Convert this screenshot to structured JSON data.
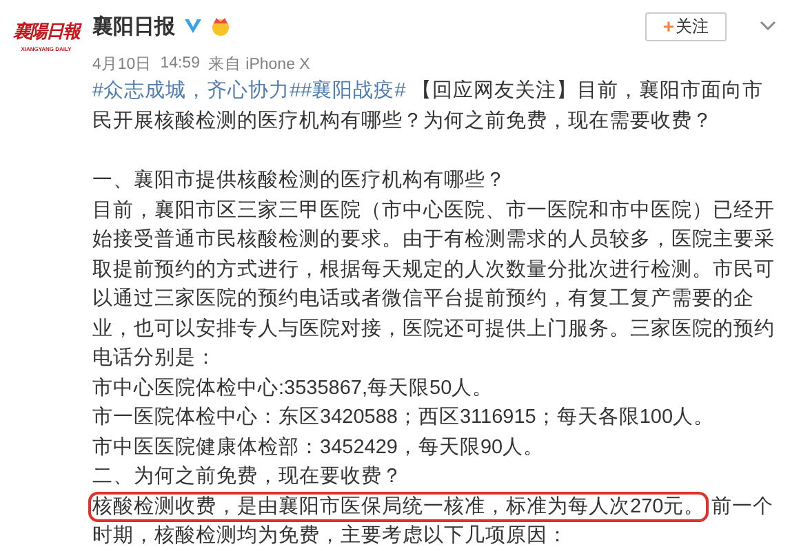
{
  "logo": {
    "title": "襄陽日報",
    "subtitle": "XIANGYANG DAILY"
  },
  "author": {
    "name": "襄阳日报",
    "verified": true
  },
  "follow_button": {
    "label": "关注",
    "icon": "+"
  },
  "meta": {
    "date": "4月10日",
    "time": "14:59",
    "source": "来自 iPhone X"
  },
  "intro": {
    "tags": [
      "#众志成城，齐心协力#",
      "#襄阳战疫#"
    ],
    "text": "【回应网友关注】目前，襄阳市面向市民开展核酸检测的医疗机构有哪些？为何之前免费，现在需要收费？"
  },
  "sections": [
    {
      "kind": "heading",
      "text": "一、襄阳市提供核酸检测的医疗机构有哪些？"
    },
    {
      "kind": "paragraph",
      "text": "目前，襄阳市区三家三甲医院（市中心医院、市一医院和市中医院）已经开始接受普通市民核酸检测的要求。由于有检测需求的人员较多，医院主要采取提前预约的方式进行，根据每天规定的人次数量分批次进行检测。市民可以通过三家医院的预约电话或者微信平台提前预约，有复工复产需要的企业，也可以安排专人与医院对接，医院还可提供上门服务。三家医院的预约电话分别是："
    },
    {
      "kind": "paragraph",
      "text": "市中心医院体检中心:3535867,每天限50人。"
    },
    {
      "kind": "paragraph",
      "text": "市一医院体检中心：东区3420588；西区3116915；每天各限100人。"
    },
    {
      "kind": "paragraph",
      "text": "市中医医院健康体检部：3452429，每天限90人。"
    },
    {
      "kind": "heading",
      "text": "二、为何之前免费，现在要收费？"
    },
    {
      "kind": "highlighted",
      "highlight": "核酸检测收费，是由襄阳市医保局统一核准，标准为每人次270元。",
      "text": "前一个时期，核酸检测均为免费，主要考虑以下几项原因："
    }
  ]
}
